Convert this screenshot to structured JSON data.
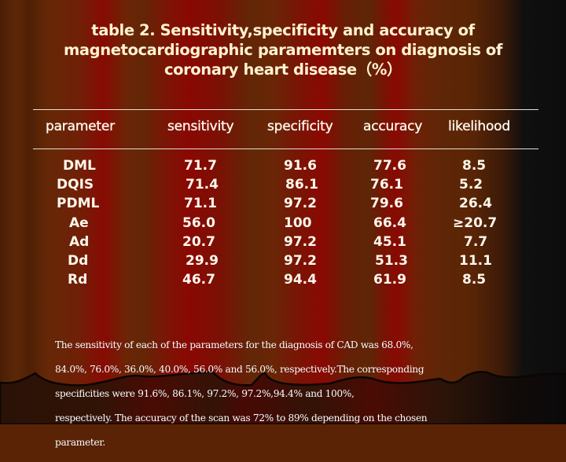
{
  "slide": {
    "title_lines": [
      "table 2. Sensitivity,specificity and accuracy of",
      "magnetocardiographic paramemters on diagnosis of",
      "coronary heart disease（%）"
    ]
  },
  "table": {
    "headers": [
      "parameter",
      "sensitivity",
      "specificity",
      "accuracy",
      "likelihood"
    ],
    "rows": [
      {
        "parameter": "DML",
        "sensitivity": "71.7",
        "specificity": "91.6",
        "accuracy": "77.6",
        "likelihood": "8.5"
      },
      {
        "parameter": "DQIS",
        "sensitivity": "71.4",
        "specificity": "86.1",
        "accuracy": "76.1",
        "likelihood": "5.2"
      },
      {
        "parameter": "PDML",
        "sensitivity": "71.1",
        "specificity": "97.2",
        "accuracy": "79.6",
        "likelihood": "26.4"
      },
      {
        "parameter": "Ae",
        "sensitivity": "56.0",
        "specificity": "100",
        "accuracy": "66.4",
        "likelihood": "≥20.7"
      },
      {
        "parameter": "Ad",
        "sensitivity": "20.7",
        "specificity": "97.2",
        "accuracy": "45.1",
        "likelihood": "7.7"
      },
      {
        "parameter": "Dd",
        "sensitivity": "29.9",
        "specificity": "97.2",
        "accuracy": "51.3",
        "likelihood": "11.1"
      },
      {
        "parameter": "Rd",
        "sensitivity": "46.7",
        "specificity": "94.4",
        "accuracy": "61.9",
        "likelihood": "8.5"
      }
    ]
  },
  "note": {
    "lines": [
      "The sensitivity of each of the parameters for the diagnosis of CAD was 68.0%,",
      "84.0%, 76.0%, 36.0%, 40.0%, 56.0% and 56.0%, respectively.The corresponding",
      "specificities were 91.6%, 86.1%, 97.2%, 97.2%,94.4% and 100%,",
      "respectively. The accuracy of the scan was 72% to 89% depending on the chosen",
      "parameter."
    ]
  },
  "theme": {
    "title_color": "#fff3d0",
    "text_color": "#fff8ec",
    "curtain_red": "#8a0903",
    "curtain_brown": "#5e2607"
  }
}
